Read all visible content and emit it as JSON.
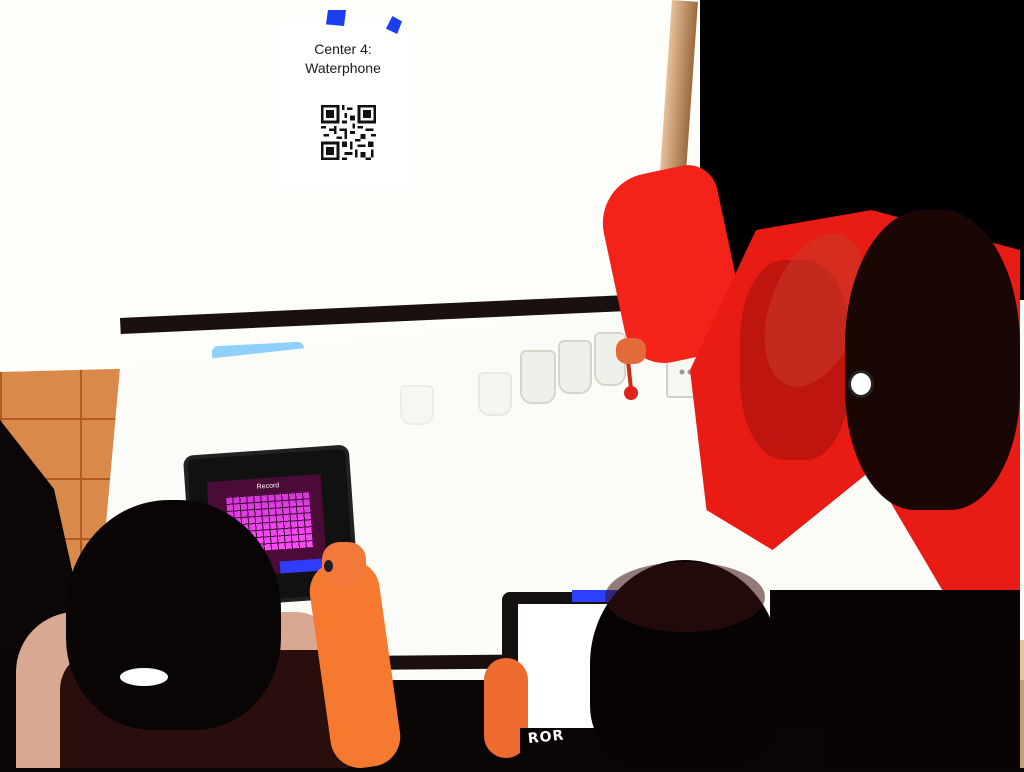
{
  "sign": {
    "title_line1": "Center 4:",
    "title_line2": "Waterphone"
  },
  "tablet_left": {
    "header_label": "Record"
  },
  "student_right": {
    "shirt_text": "ROR"
  },
  "icons": {
    "qr": "qr-code-icon"
  },
  "colors": {
    "jacket": "#e81c14",
    "tablet_grid": "#ff4dff",
    "sign_tabs": "#1a3df0"
  }
}
